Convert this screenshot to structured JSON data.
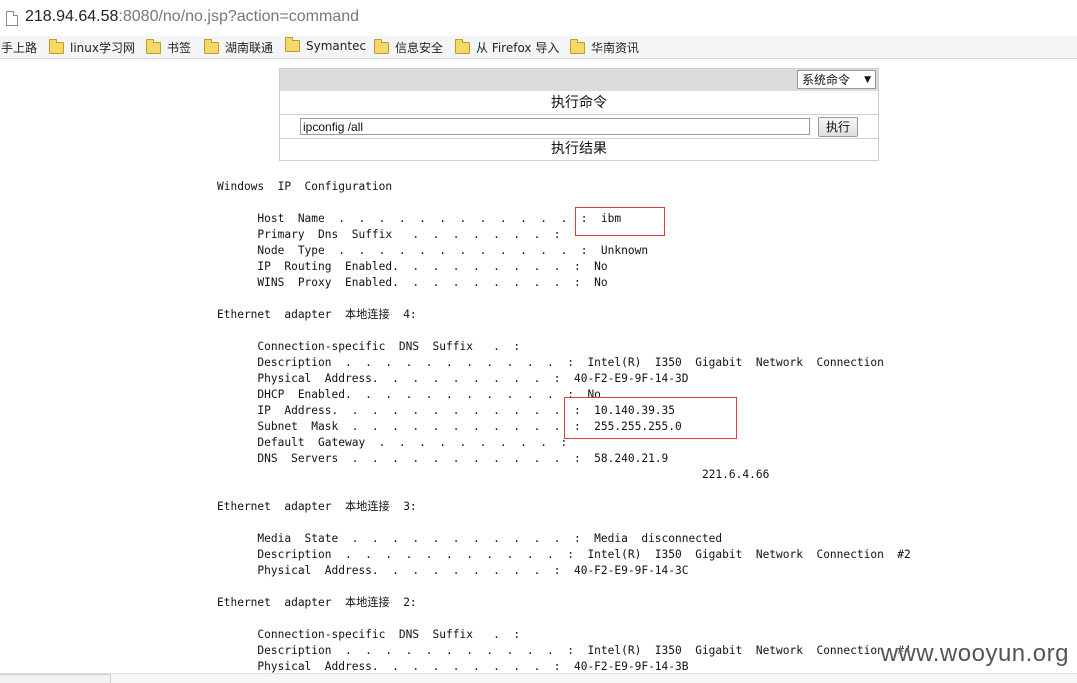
{
  "browser": {
    "url_host": "218.94.64.58",
    "url_rest": ":8080/no/no.jsp?action=command"
  },
  "bookmarks": [
    {
      "label": "手上路",
      "folder": false
    },
    {
      "label": "linux学习网",
      "folder": true
    },
    {
      "label": "书签",
      "folder": true
    },
    {
      "label": "湖南联通",
      "folder": true
    },
    {
      "label": "Symantec",
      "folder": true
    },
    {
      "label": "信息安全",
      "folder": true
    },
    {
      "label": "从 Firefox 导入",
      "folder": true
    },
    {
      "label": "华南资讯",
      "folder": true
    }
  ],
  "panel": {
    "select_value": "系统命令",
    "exec_title": "执行命令",
    "command_value": "ipconfig /all",
    "exec_button": "执行",
    "result_title": "执行结果"
  },
  "output_text": "Windows  IP  Configuration\n\n      Host  Name  .  .  .  .  .  .  .  .  .  .  .  .  :  ibm\n      Primary  Dns  Suffix   .  .  .  .  .  .  .  :\n      Node  Type  .  .  .  .  .  .  .  .  .  .  .  .  :  Unknown\n      IP  Routing  Enabled.  .  .  .  .  .  .  .  .  :  No\n      WINS  Proxy  Enabled.  .  .  .  .  .  .  .  .  :  No\n\nEthernet  adapter  本地连接  4:\n\n      Connection-specific  DNS  Suffix   .  :\n      Description  .  .  .  .  .  .  .  .  .  .  .  :  Intel(R)  I350  Gigabit  Network  Connection\n      Physical  Address.  .  .  .  .  .  .  .  .  :  40-F2-E9-9F-14-3D\n      DHCP  Enabled.  .  .  .  .  .  .  .  .  .  .  :  No\n      IP  Address.  .  .  .  .  .  .  .  .  .  .  .  :  10.140.39.35\n      Subnet  Mask  .  .  .  .  .  .  .  .  .  .  .  :  255.255.255.0\n      Default  Gateway  .  .  .  .  .  .  .  .  .  :\n      DNS  Servers  .  .  .  .  .  .  .  .  .  .  .  :  58.240.21.9\n                                                                        221.6.4.66\n\nEthernet  adapter  本地连接  3:\n\n      Media  State  .  .  .  .  .  .  .  .  .  .  .  :  Media  disconnected\n      Description  .  .  .  .  .  .  .  .  .  .  .  :  Intel(R)  I350  Gigabit  Network  Connection  #2\n      Physical  Address.  .  .  .  .  .  .  .  .  :  40-F2-E9-9F-14-3C\n\nEthernet  adapter  本地连接  2:\n\n      Connection-specific  DNS  Suffix   .  :\n      Description  .  .  .  .  .  .  .  .  .  .  .  :  Intel(R)  I350  Gigabit  Network  Connection  #4\n      Physical  Address.  .  .  .  .  .  .  .  .  :  40-F2-E9-9F-14-3B",
  "watermark": "www.wooyun.org",
  "colors": {
    "highlight": "#e23a3a",
    "panel_header": "#dcdcdc"
  }
}
